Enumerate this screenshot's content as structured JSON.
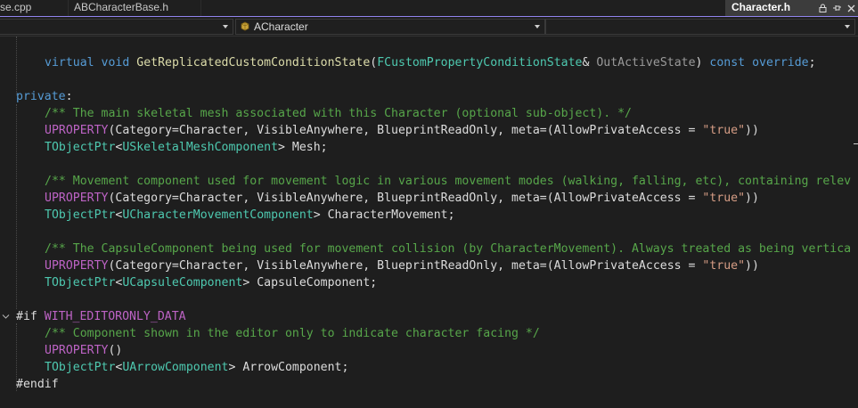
{
  "tabs": [
    {
      "label": "se.cpp"
    },
    {
      "label": "ABCharacterBase.h"
    },
    {
      "label": "Character.h",
      "active": true
    }
  ],
  "navbar": {
    "scope": "",
    "class_name": "ACharacter",
    "member": ""
  },
  "code": {
    "line1": {
      "kw1": "virtual",
      "kw2": "void",
      "fn": "GetReplicatedCustomConditionState",
      "p1": "(",
      "type": "FCustomPropertyConditionState",
      "amp": "& ",
      "param": "OutActiveState",
      "p2": ") ",
      "kw3": "const",
      "kw4": "override",
      "semi": ";"
    },
    "line2": {
      "kw": "private",
      "colon": ":"
    },
    "line3": {
      "comment": "/** The main skeletal mesh associated with this Character (optional sub-object). */"
    },
    "line4": {
      "macro": "UPROPERTY",
      "args_pre": "(Category=Character, VisibleAnywhere, BlueprintReadOnly, meta=(AllowPrivateAccess = ",
      "str": "\"true\"",
      "args_post": "))"
    },
    "line5": {
      "tmpl": "TObjectPtr",
      "lt": "<",
      "type": "USkeletalMeshComponent",
      "gt": "> Mesh;"
    },
    "line6": {
      "comment": "/** Movement component used for movement logic in various movement modes (walking, falling, etc), containing relev"
    },
    "line7": {
      "macro": "UPROPERTY",
      "args_pre": "(Category=Character, VisibleAnywhere, BlueprintReadOnly, meta=(AllowPrivateAccess = ",
      "str": "\"true\"",
      "args_post": "))"
    },
    "line8": {
      "tmpl": "TObjectPtr",
      "lt": "<",
      "type": "UCharacterMovementComponent",
      "gt": "> CharacterMovement;"
    },
    "line9": {
      "comment": "/** The CapsuleComponent being used for movement collision (by CharacterMovement). Always treated as being vertica"
    },
    "line10": {
      "macro": "UPROPERTY",
      "args_pre": "(Category=Character, VisibleAnywhere, BlueprintReadOnly, meta=(AllowPrivateAccess = ",
      "str": "\"true\"",
      "args_post": "))"
    },
    "line11": {
      "tmpl": "TObjectPtr",
      "lt": "<",
      "type": "UCapsuleComponent",
      "gt": "> CapsuleComponent;"
    },
    "line12": {
      "directive": "#if",
      "macro": "WITH_EDITORONLY_DATA"
    },
    "line13": {
      "comment": "/** Component shown in the editor only to indicate character facing */"
    },
    "line14": {
      "macro": "UPROPERTY",
      "args": "()"
    },
    "line15": {
      "tmpl": "TObjectPtr",
      "lt": "<",
      "type": "UArrowComponent",
      "gt": "> ArrowComponent;"
    },
    "line16": {
      "directive": "#endif"
    }
  },
  "colors": {
    "keyword": "#569cd6",
    "type": "#4ec9b0",
    "function": "#dcdcaa",
    "macro": "#bd63c5",
    "comment": "#57a64a",
    "string": "#d69d85",
    "parameter": "#9a9a9a",
    "accent": "#9184ee"
  }
}
